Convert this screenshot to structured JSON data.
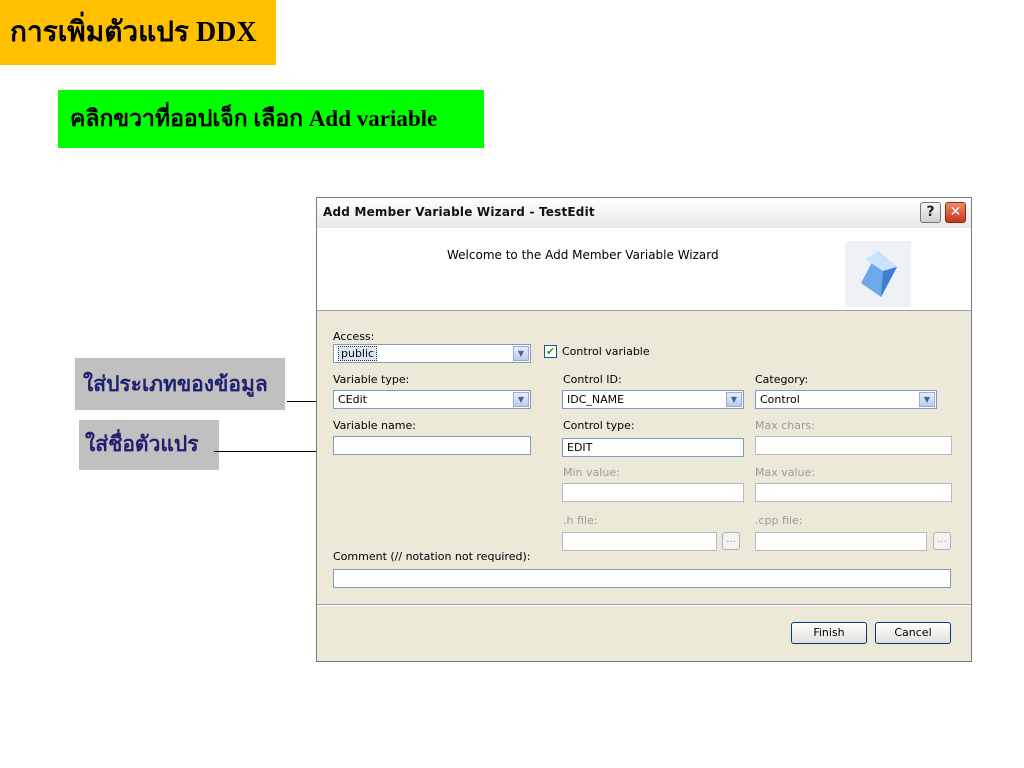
{
  "slide": {
    "title": "การเพิ่มตัวแปร DDX",
    "instruction": "คลิกขวาที่ออปเจ็ก เลือก Add variable",
    "callout_type": "ใส่ประเภทของข้อมูล",
    "callout_name": "ใส่ชื่อตัวแปร"
  },
  "dialog": {
    "title": "Add Member Variable Wizard - TestEdit",
    "help_glyph": "?",
    "close_glyph": "✕",
    "welcome": "Welcome to the Add Member Variable Wizard",
    "access_label": "Access:",
    "access_value": "public",
    "control_variable_label": "Control variable",
    "control_variable_checked": true,
    "variable_type_label": "Variable type:",
    "variable_type_value": "CEdit",
    "control_id_label": "Control ID:",
    "control_id_value": "IDC_NAME",
    "category_label": "Category:",
    "category_value": "Control",
    "variable_name_label": "Variable name:",
    "variable_name_value": "",
    "control_type_label": "Control type:",
    "control_type_value": "EDIT",
    "max_chars_label": "Max chars:",
    "min_value_label": "Min value:",
    "max_value_label": "Max value:",
    "h_file_label": ".h file:",
    "cpp_file_label": ".cpp file:",
    "browse_label": "...",
    "comment_label": "Comment (// notation not required):",
    "comment_value": "",
    "finish_label": "Finish",
    "cancel_label": "Cancel"
  },
  "icons": {
    "dropdown": "chevron-down-icon",
    "check": "check-icon",
    "logo": "wizard-cube-icon"
  }
}
